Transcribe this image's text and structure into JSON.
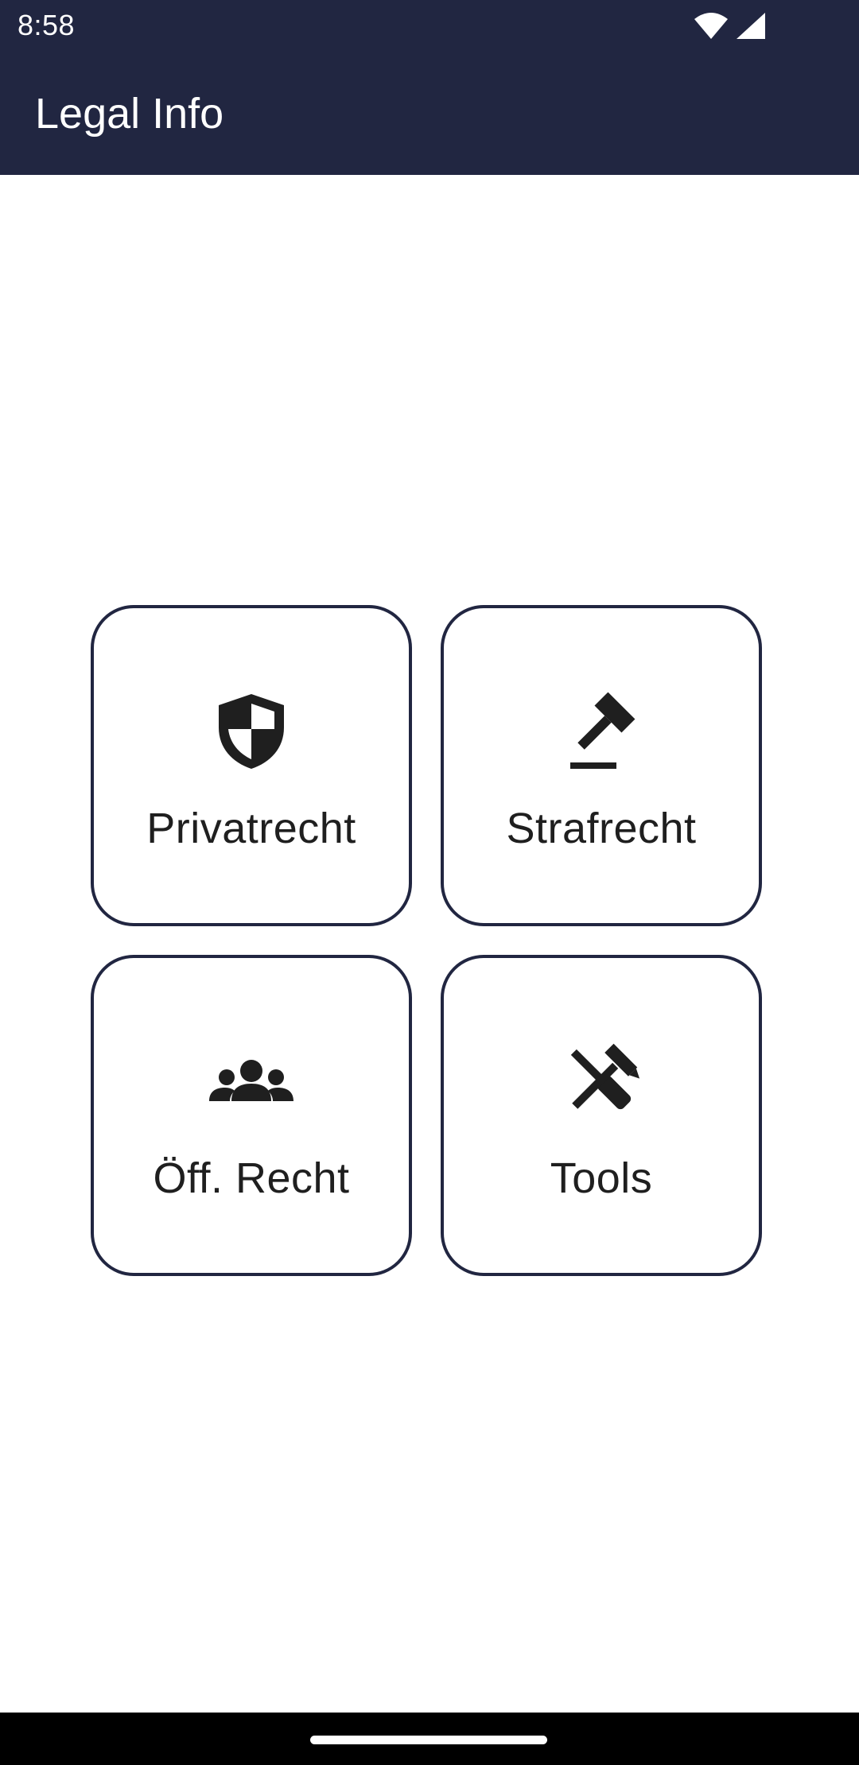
{
  "status_bar": {
    "time": "8:58",
    "icons": [
      "wifi-icon",
      "cell-signal-icon"
    ]
  },
  "app_bar": {
    "title": "Legal Info"
  },
  "tiles": [
    {
      "label": "Privatrecht",
      "icon": "shield-icon"
    },
    {
      "label": "Strafrecht",
      "icon": "gavel-icon"
    },
    {
      "label": "Öff. Recht",
      "icon": "groups-icon"
    },
    {
      "label": "Tools",
      "icon": "tools-icon"
    }
  ],
  "colors": {
    "primary": "#212641",
    "background": "#ffffff",
    "icon": "#1f1f1f",
    "text": "#1f1f1f"
  }
}
